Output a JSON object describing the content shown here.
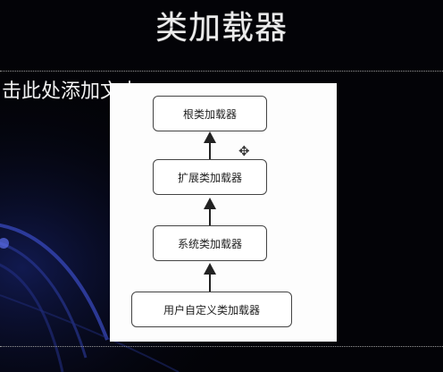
{
  "slide": {
    "title": "类加载器",
    "placeholder_text": "击此处添加文本"
  },
  "diagram": {
    "nodes": [
      {
        "label": "根类加载器"
      },
      {
        "label": "扩展类加载器"
      },
      {
        "label": "系统类加载器"
      },
      {
        "label": "用户自定义类加载器"
      }
    ],
    "cursor_icon": "move-cursor-icon"
  },
  "colors": {
    "background": "#030307",
    "title": "#ececec",
    "swirl": "#2a3aa8"
  }
}
